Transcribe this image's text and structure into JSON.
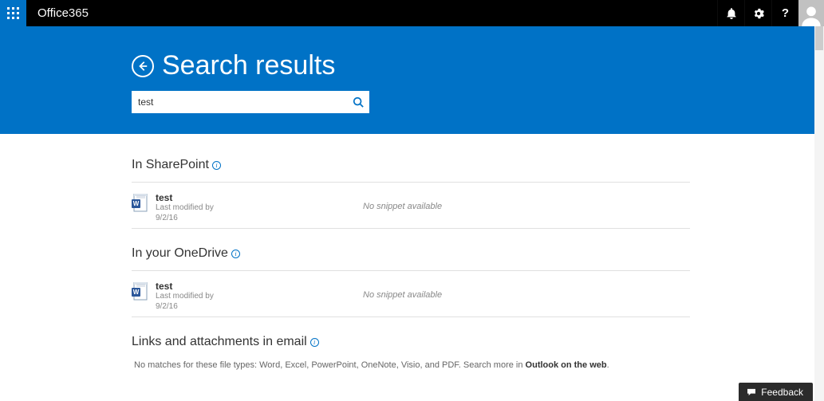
{
  "topbar": {
    "brand_prefix": "Office",
    "brand_suffix": " 365"
  },
  "hero": {
    "title": "Search results",
    "search_value": "test"
  },
  "sections": {
    "sharepoint": {
      "title": "In SharePoint",
      "result": {
        "name": "test",
        "modified_label": "Last modified by",
        "date": "9/2/16",
        "snippet": "No snippet available"
      }
    },
    "onedrive": {
      "title": "In your OneDrive",
      "result": {
        "name": "test",
        "modified_label": "Last modified by",
        "date": "9/2/16",
        "snippet": "No snippet available"
      }
    },
    "email": {
      "title": "Links and attachments in email",
      "note_prefix": "No matches for these file types: Word, Excel, PowerPoint, OneNote, Visio, and PDF. Search more in ",
      "note_link": "Outlook on the web",
      "note_suffix": "."
    }
  },
  "feedback": {
    "label": "Feedback"
  }
}
